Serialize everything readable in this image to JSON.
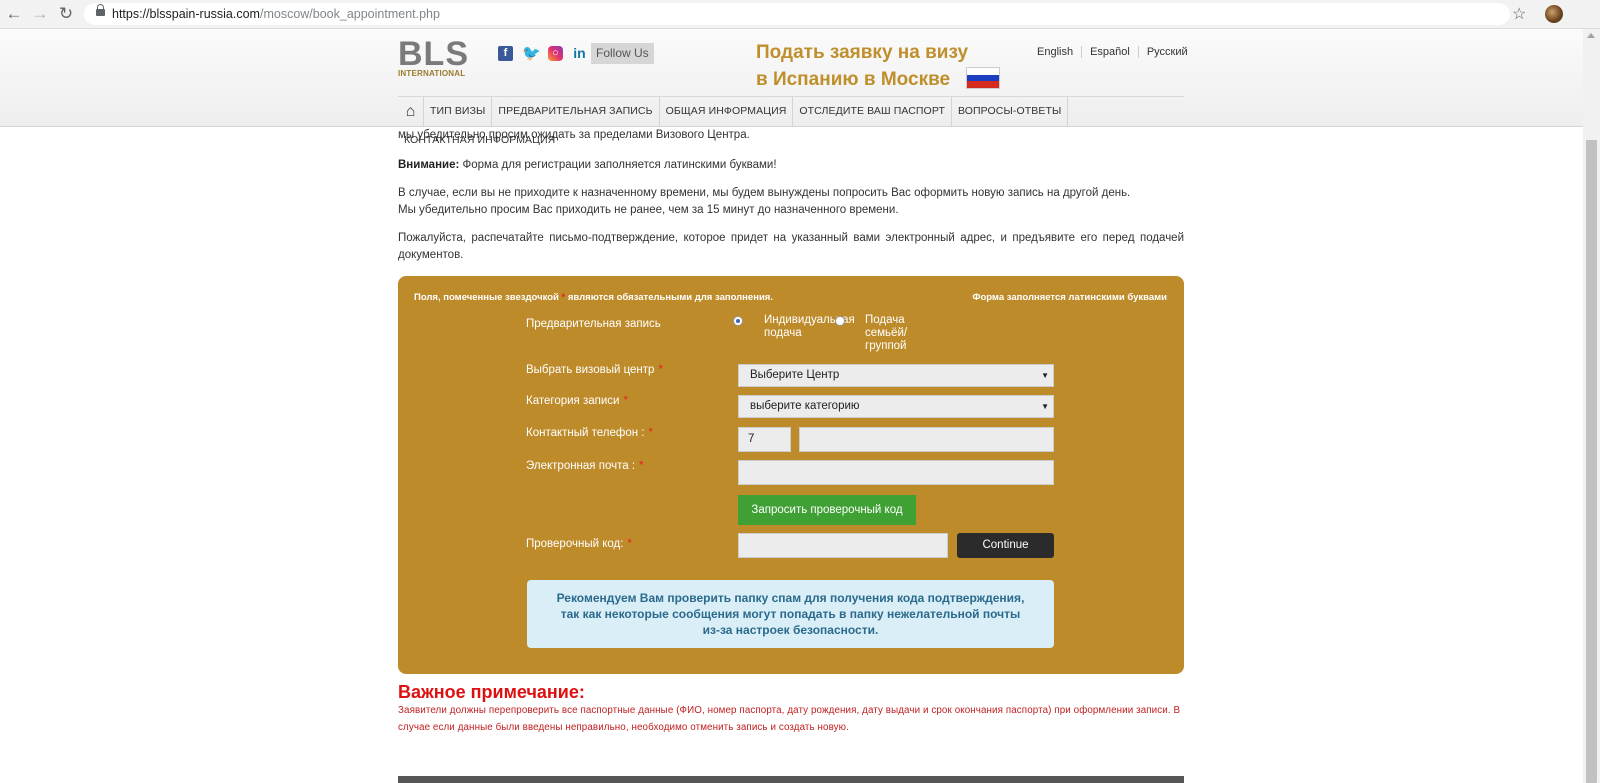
{
  "browser": {
    "url_host": "https://blsspain-russia.com",
    "url_path": "/moscow/book_appointment.php",
    "back_icon": "arrow-left",
    "forward_icon": "arrow-right",
    "reload_icon": "reload"
  },
  "header": {
    "logo_main": "BLS",
    "logo_sub": "INTERNATIONAL",
    "follow_us": "Follow Us",
    "title_line1": "Подать заявку на визу",
    "title_line2": "в Испанию в Москве",
    "flag_colors": [
      "#ffffff",
      "#1c3fbf",
      "#d52b1e"
    ],
    "languages": [
      "English",
      "Español",
      "Русский"
    ]
  },
  "menu": [
    "ТИП ВИЗЫ",
    "ПРЕДВАРИТЕЛЬНАЯ ЗАПИСЬ",
    "ОБЩАЯ ИНФОРМАЦИЯ",
    "ОТСЛЕДИТЕ ВАШ ПАСПОРТ",
    "ВОПРОСЫ-ОТВЕТЫ",
    "КОНТАКТНАЯ ИНФОРМАЦИЯ"
  ],
  "content": {
    "p0": "мы убедительно просим ожидать за пределами Визового Центра.",
    "attention_label": "Внимание:",
    "attention_text": " Форма для регистрации заполняется латинскими буквами!",
    "p2a": "В случае, если вы не приходите к назначенному времени, мы будем вынуждены попросить Вас оформить новую запись на другой день.",
    "p2b": "Мы убедительно просим Вас приходить не ранее, чем за 15 минут до назначенного времени.",
    "p3": "Пожалуйста, распечатайте письмо-подтверждение, которое придет на указанный вами электронный адрес, и предъявите его перед подачей документов."
  },
  "form": {
    "note_left_a": "Поля, помеченные звездочкой",
    "note_left_star": " * ",
    "note_left_b": "являются обязательными для заполнения.",
    "note_right": "Форма заполняется латинскими буквами",
    "appointment_label": "Предварительная запись",
    "radio_individual": "Индивидуальная подача",
    "radio_family": "Подача семьёй/группой",
    "center_label": "Выбрать визовый центр",
    "center_value": "Выберите Центр",
    "category_label": "Категория записи",
    "category_value": "выберите категорию",
    "phone_label": "Контактный телефон :",
    "phone_code": "7",
    "phone_number": "",
    "email_label": "Электронная почта :",
    "email_value": "",
    "request_code_button": "Запросить проверочный код",
    "verify_label": "Проверочный код:",
    "verify_value": "",
    "continue_button": "Continue",
    "required_mark": "*",
    "info_line1": "Рекомендуем Вам проверить папку спам для получения кода подтверждения,",
    "info_line2": "так как некоторые сообщения могут попадать в папку нежелательной почты",
    "info_line3": "из-за настроек безопасности."
  },
  "important": {
    "title": "Важное примечание:",
    "text": "Заявители должны перепроверить все паспортные данные (ФИО, номер паспорта, дату рождения, дату выдачи и срок окончания паспорта) при оформлении записи. В случае если данные были введены неправильно, необходимо отменить запись и создать новую."
  },
  "colors": {
    "form_bg": "#be8b2b",
    "title_gold": "#bf8f2c",
    "green_button": "#3fa034",
    "important_red": "#d11111"
  }
}
